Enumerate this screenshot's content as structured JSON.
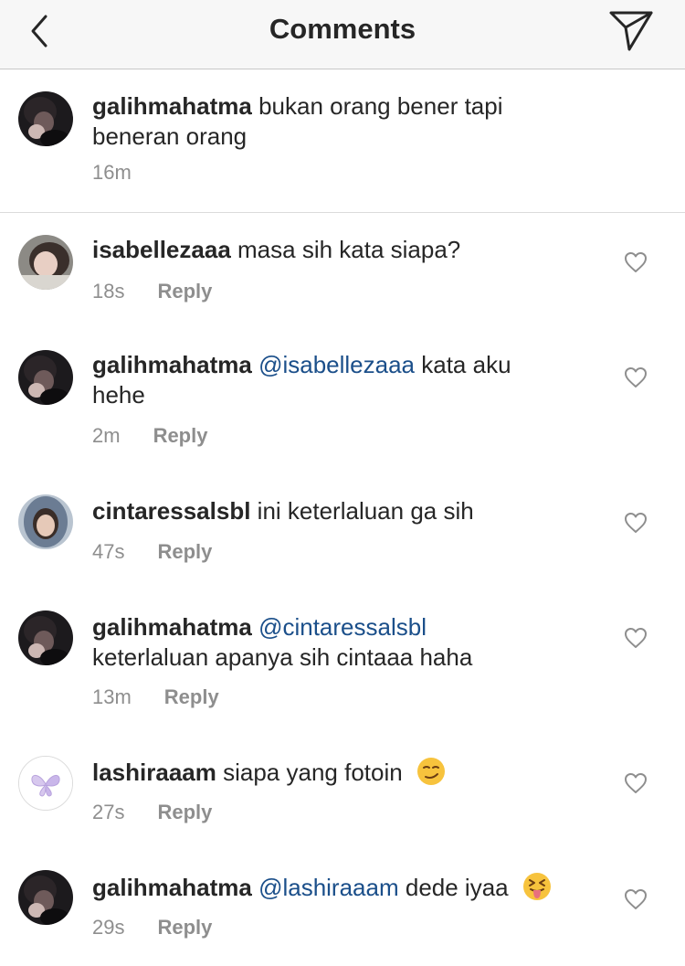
{
  "header": {
    "title": "Comments",
    "back_icon": "chevron-left-icon",
    "send_icon": "paper-plane-icon"
  },
  "caption": {
    "username": "galihmahatma",
    "text": "bukan orang bener tapi beneran orang",
    "time": "16m"
  },
  "comments": [
    {
      "username": "isabellezaaa",
      "mention": "",
      "text": "masa sih kata siapa?",
      "time": "18s",
      "reply": "Reply",
      "avatar": "light-photo"
    },
    {
      "username": "galihmahatma",
      "mention": "@isabellezaaa",
      "text": "kata aku hehe",
      "time": "2m",
      "reply": "Reply",
      "avatar": "dark-photo"
    },
    {
      "username": "cintaressalsbl",
      "mention": "",
      "text": "ini keterlaluan ga sih",
      "time": "47s",
      "reply": "Reply",
      "avatar": "hood-photo"
    },
    {
      "username": "galihmahatma",
      "mention": "@cintaressalsbl",
      "text": "keterlaluan apanya sih cintaaa haha",
      "time": "13m",
      "reply": "Reply",
      "avatar": "dark-photo"
    },
    {
      "username": "lashiraaam",
      "mention": "",
      "text": "siapa yang fotoin",
      "emoji": "smirking-face",
      "time": "27s",
      "reply": "Reply",
      "avatar": "butterfly"
    },
    {
      "username": "galihmahatma",
      "mention": "@lashiraaam",
      "text": "dede iyaa",
      "emoji": "squinting-tongue-face",
      "time": "29s",
      "reply": "Reply",
      "avatar": "dark-photo"
    }
  ],
  "colors": {
    "mention": "#1b4f8a",
    "meta": "#8e8e8e",
    "text": "#262626",
    "header_bg": "#f7f7f7"
  }
}
